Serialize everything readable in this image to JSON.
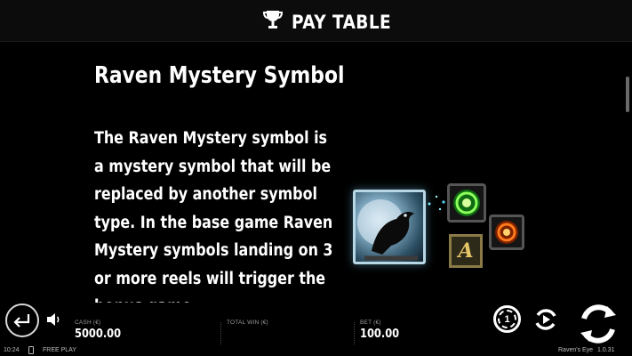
{
  "header": {
    "title": "PAY TABLE",
    "icon": "trophy-icon"
  },
  "section": {
    "title": "Raven Mystery Symbol",
    "description": "The Raven Mystery symbol is a mystery symbol that will be replaced by another symbol type. In the base game Raven Mystery symbols landing on 3 or more reels will trigger the bonus game."
  },
  "artwork": {
    "a_letter": "A"
  },
  "footer": {
    "cash_label": "CASH (€)",
    "cash_value": "5000.00",
    "total_win_label": "TOTAL WIN (€)",
    "total_win_value": "",
    "bet_label": "BET (€)",
    "bet_value": "100.00",
    "coin_value": "1",
    "time": "10:24",
    "mode": "FREE PLAY",
    "game_name": "Raven's Eye",
    "version": "1.0.31"
  }
}
